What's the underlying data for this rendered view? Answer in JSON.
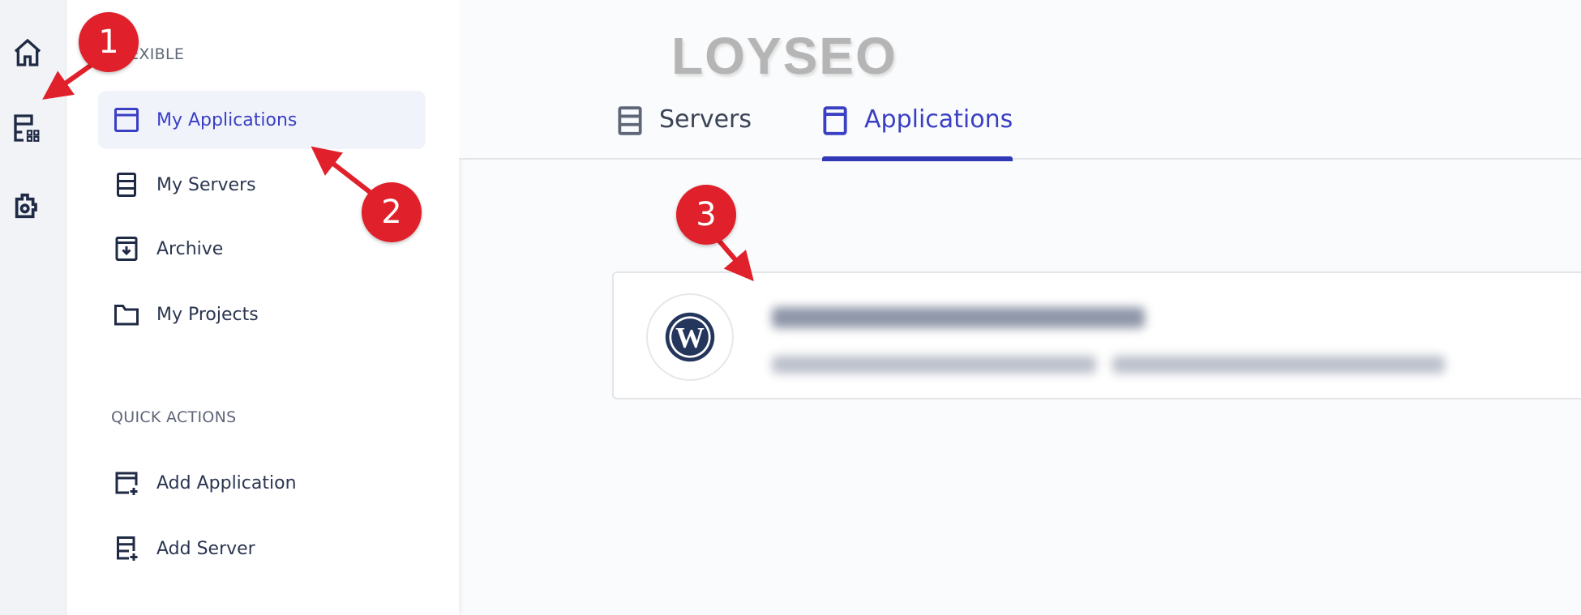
{
  "rail": {
    "icons": [
      "home-icon",
      "apps-servers-icon",
      "settings-puzzle-icon"
    ]
  },
  "sidebar": {
    "section_title": "FLEXIBLE",
    "items": [
      {
        "label": "My Applications",
        "icon": "window-icon",
        "active": true
      },
      {
        "label": "My Servers",
        "icon": "server-icon"
      },
      {
        "label": "Archive",
        "icon": "archive-icon"
      },
      {
        "label": "My Projects",
        "icon": "folder-icon"
      }
    ],
    "quick_actions_title": "QUICK ACTIONS",
    "quick_actions": [
      {
        "label": "Add Application",
        "icon": "add-window-icon"
      },
      {
        "label": "Add Server",
        "icon": "add-server-icon"
      }
    ]
  },
  "header": {
    "logo": "LOYSEO",
    "tabs": [
      {
        "label": "Servers",
        "icon": "server-icon"
      },
      {
        "label": "Applications",
        "icon": "window-icon",
        "active": true
      }
    ]
  },
  "application_card": {
    "icon": "wordpress-icon"
  },
  "annotations": [
    "1",
    "2",
    "3"
  ],
  "colors": {
    "accent": "#3a3fc4",
    "marker": "#e0202a"
  }
}
